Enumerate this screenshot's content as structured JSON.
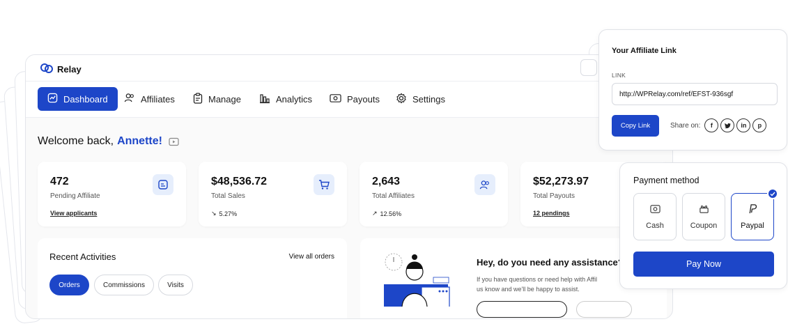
{
  "app": {
    "name": "Relay"
  },
  "nav": {
    "items": [
      {
        "label": "Dashboard",
        "icon": "chart-icon",
        "active": true
      },
      {
        "label": "Affiliates",
        "icon": "users-icon"
      },
      {
        "label": "Manage",
        "icon": "clipboard-icon"
      },
      {
        "label": "Analytics",
        "icon": "bar-chart-icon"
      },
      {
        "label": "Payouts",
        "icon": "banknote-icon"
      },
      {
        "label": "Settings",
        "icon": "gear-icon"
      }
    ]
  },
  "welcome": {
    "prefix": "Welcome back,",
    "name": "Annette!"
  },
  "stats": [
    {
      "value": "472",
      "label": "Pending Affiliate",
      "sub": "View applicants",
      "icon": "document-icon"
    },
    {
      "value": "$48,536.72",
      "label": "Total Sales",
      "sub": "5.27%",
      "trend": "down",
      "icon": "cart-icon"
    },
    {
      "value": "2,643",
      "label": "Total Affiliates",
      "sub": "12.56%",
      "trend": "up",
      "icon": "users-icon"
    },
    {
      "value": "$52,273.97",
      "label": "Total Payouts",
      "sub": "12 pendings"
    }
  ],
  "activities": {
    "title": "Recent Activities",
    "link": "View all orders",
    "tabs": [
      "Orders",
      "Commissions",
      "Visits"
    ]
  },
  "assist": {
    "title": "Hey, do you need any assistance?",
    "text1": "If you have questions or need help with Affil",
    "text2": "us know and we'll be happy to assist."
  },
  "affiliate": {
    "title": "Your Affiliate Link",
    "field_label": "LINK",
    "url": "http://WPRelay.com/ref/EFST-936sgf",
    "copy": "Copy Link",
    "share": "Share on:",
    "socials": [
      "facebook-icon",
      "twitter-icon",
      "linkedin-icon",
      "pinterest-icon"
    ]
  },
  "payment": {
    "title": "Payment method",
    "methods": [
      {
        "label": "Cash",
        "icon": "cash-icon"
      },
      {
        "label": "Coupon",
        "icon": "coupon-icon"
      },
      {
        "label": "Paypal",
        "icon": "paypal-icon",
        "selected": true
      }
    ],
    "button": "Pay Now"
  },
  "colors": {
    "accent": "#1d46c8",
    "tint": "#e6eefc"
  }
}
